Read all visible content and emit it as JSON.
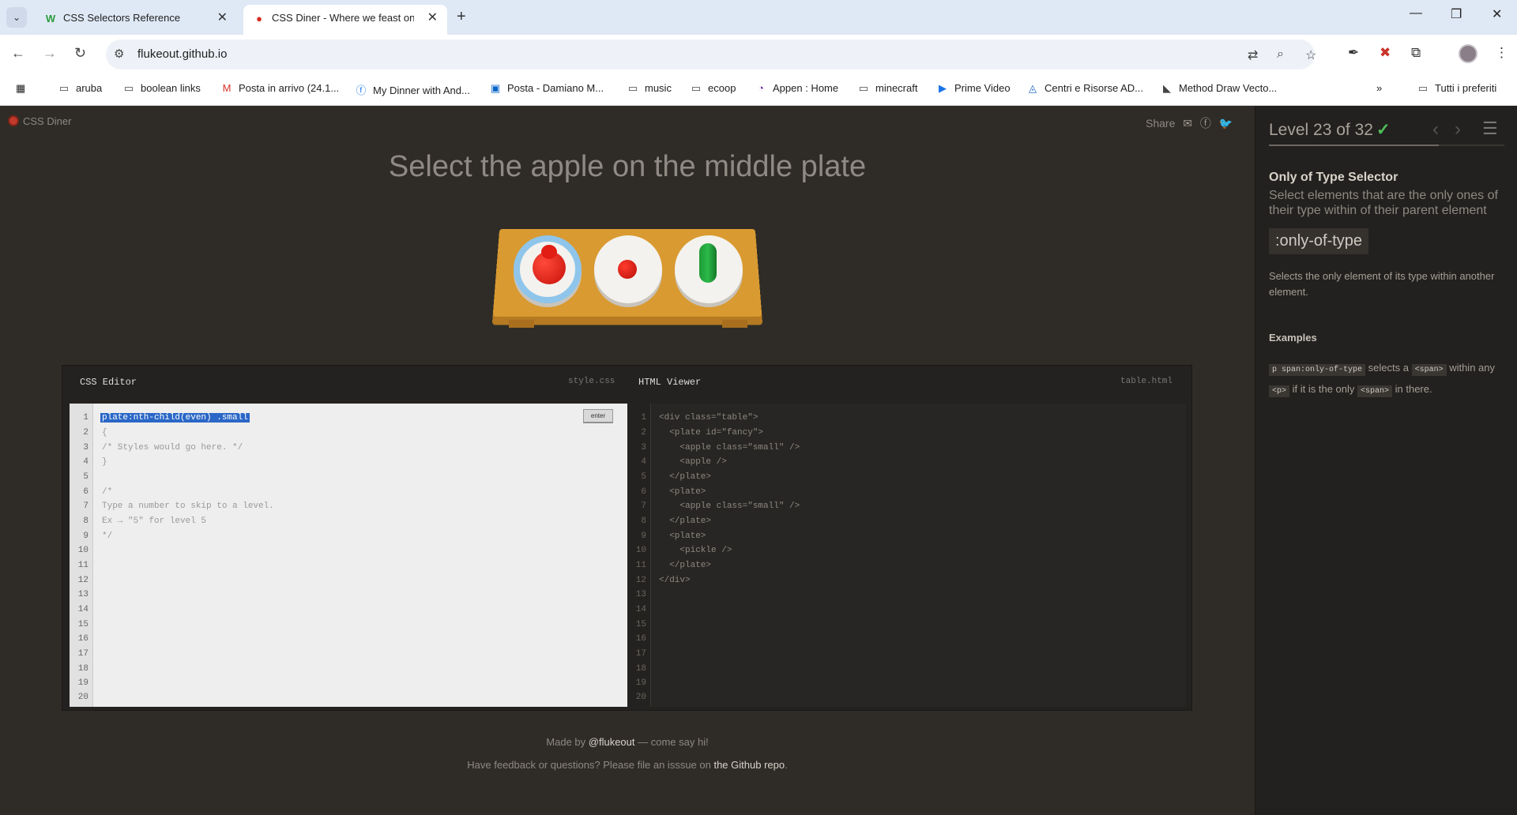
{
  "browser": {
    "tabs": [
      {
        "title": "CSS Selectors Reference",
        "favicon": "W"
      },
      {
        "title": "CSS Diner - Where we feast on",
        "favicon": "●"
      }
    ],
    "url": "flukeout.github.io",
    "bookmarks": [
      "aruba",
      "boolean links",
      "Posta in arrivo (24.1...",
      "My Dinner with And...",
      "Posta - Damiano M...",
      "music",
      "ecoop",
      "Appen : Home",
      "minecraft",
      "Prime Video",
      "Centri e Risorse AD...",
      "Method Draw Vecto...",
      "Tutti i preferiti"
    ]
  },
  "app": {
    "logo": "CSS Diner",
    "share_label": "Share",
    "instruction": "Select the apple on the middle plate"
  },
  "editor": {
    "css_title": "CSS Editor",
    "css_file": "style.css",
    "html_title": "HTML Viewer",
    "html_file": "table.html",
    "enter_label": "enter",
    "input_value": "plate:nth-child(even) .small",
    "css_lines": [
      "{",
      "/* Styles would go here. */",
      "}",
      "",
      "/*",
      "Type a number to skip to a level.",
      "Ex → \"5\" for level 5",
      "*/"
    ],
    "html_lines": [
      "<div class=\"table\">",
      "  <plate id=\"fancy\">",
      "    <apple class=\"small\" />",
      "    <apple />",
      "  </plate>",
      "  <plate>",
      "    <apple class=\"small\" />",
      "  </plate>",
      "  <plate>",
      "    <pickle />",
      "  </plate>",
      "</div>"
    ]
  },
  "footer": {
    "line1_pre": "Made by ",
    "line1_link": "@flukeout",
    "line1_post": " — come say hi!",
    "line2_pre": "Have feedback or questions? Please file an isssue on ",
    "line2_link": "the Github repo",
    "line2_post": "."
  },
  "sidebar": {
    "level_text": "Level 23 of 32",
    "level_progress": 0.72,
    "selector_name": "Only of Type Selector",
    "selector_title": "Select elements that are the only ones of their type within of their parent element",
    "syntax": ":only-of-type",
    "hint": "Selects the only element of its type within another element.",
    "examples_title": "Examples",
    "example_code1": "p span:only-of-type",
    "example_t1": " selects a ",
    "example_code2": "<span>",
    "example_t2": " within any ",
    "example_code3": "<p>",
    "example_t3": " if it is the only ",
    "example_code4": "<span>",
    "example_t4": " in there."
  }
}
